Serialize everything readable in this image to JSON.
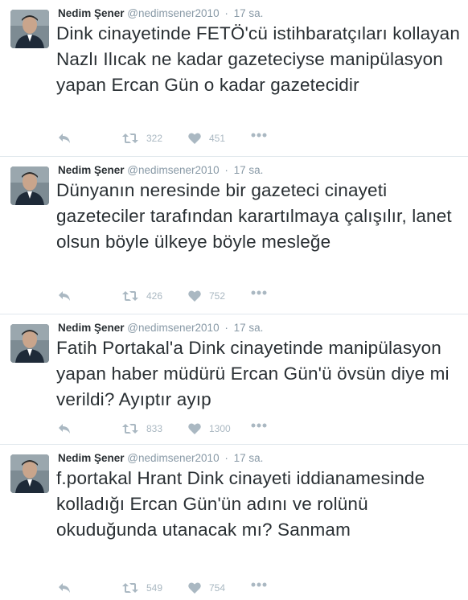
{
  "tweets": [
    {
      "name": "Nedim Şener",
      "handle": "@nedimsener2010",
      "separator": "·",
      "time": "17 sa.",
      "text": "Dink cinayetinde FETÖ'cü istihbaratçıları kollayan Nazlı Ilıcak ne kadar gazeteciyse manipülasyon yapan Ercan Gün o kadar gazetecidir",
      "retweets": "322",
      "likes": "451"
    },
    {
      "name": "Nedim Şener",
      "handle": "@nedimsener2010",
      "separator": "·",
      "time": "17 sa.",
      "text": "Dünyanın neresinde bir gazeteci cinayeti gazeteciler tarafından karartılmaya çalışılır, lanet olsun böyle ülkeye böyle mesleğe",
      "retweets": "426",
      "likes": "752"
    },
    {
      "name": "Nedim Şener",
      "handle": "@nedimsener2010",
      "separator": "·",
      "time": "17 sa.",
      "text": "Fatih Portakal'a Dink cinayetinde manipülasyon yapan haber müdürü Ercan Gün'ü övsün diye mi verildi? Ayıptır ayıp",
      "retweets": "833",
      "likes": "1300"
    },
    {
      "name": "Nedim Şener",
      "handle": "@nedimsener2010",
      "separator": "·",
      "time": "17 sa.",
      "text": "f.portakal Hrant Dink cinayeti iddianamesinde kolladığı Ercan Gün'ün adını ve rolünü okuduğunda utanacak mı? Sanmam",
      "retweets": "549",
      "likes": "754"
    }
  ],
  "icons": {
    "reply": "reply-icon",
    "retweet": "retweet-icon",
    "like": "heart-icon",
    "more": "more-icon"
  },
  "colors": {
    "text": "#292f33",
    "muted": "#8899a6",
    "action": "#aab8c2",
    "divider": "#e1e8ed"
  }
}
